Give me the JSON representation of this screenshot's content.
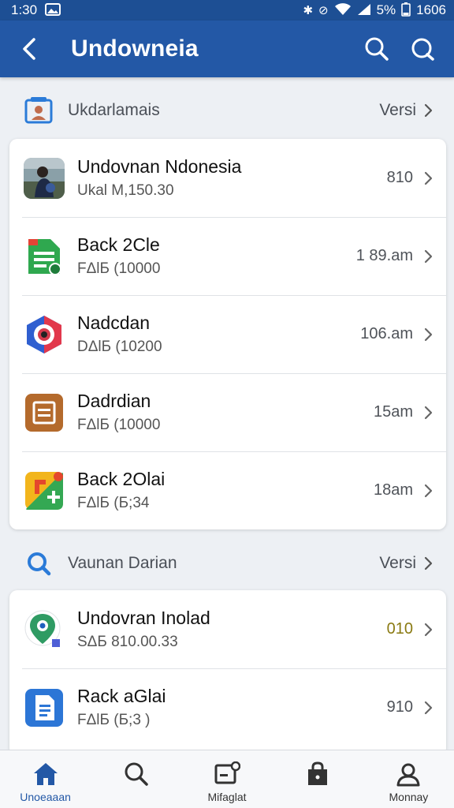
{
  "status_bar": {
    "time": "1:30",
    "battery": "5%",
    "clock_right": "1606"
  },
  "app_bar": {
    "title": "Undowneia"
  },
  "section1": {
    "title": "Ukdarlamais",
    "action": "Versi",
    "items": [
      {
        "title": "Undovnan Ndonesia",
        "subtitle": "Ukal M,150.30",
        "meta": "810",
        "icon": "photo-avatar-icon"
      },
      {
        "title": "Back 2Cle",
        "subtitle": "FΔlБ (10000",
        "meta": "1 89.am",
        "icon": "sheets-icon"
      },
      {
        "title": "Nadcdan",
        "subtitle": "DΔlБ (10200",
        "meta": "106.am",
        "icon": "target-icon"
      },
      {
        "title": "Dadrdian",
        "subtitle": "FΔlБ (10000",
        "meta": "15am",
        "icon": "notes-icon"
      },
      {
        "title": "Back 2Olai",
        "subtitle": "FΔlБ (Б;34",
        "meta": "18am",
        "icon": "colorful-app-icon"
      }
    ]
  },
  "section2": {
    "title": "Vaunan Darian",
    "action": "Versi",
    "items": [
      {
        "title": "Undovran Inolad",
        "subtitle": "SΔБ 810.00.33",
        "meta": "010",
        "icon": "location-pin-icon"
      },
      {
        "title": "Rack aGlai",
        "subtitle": "FΔlБ (Б;3 )",
        "meta": "910",
        "icon": "docs-icon"
      }
    ]
  },
  "bottom_nav": [
    {
      "label": "Unoeaaan",
      "icon": "home-icon"
    },
    {
      "label": "",
      "icon": "search-icon"
    },
    {
      "label": "Mifaglat",
      "icon": "message-icon"
    },
    {
      "label": "",
      "icon": "bag-icon"
    },
    {
      "label": "Monnay",
      "icon": "profile-icon"
    }
  ],
  "colors": {
    "app_bar": "#2358a6",
    "status_bar": "#1d4f94",
    "accent": "#2358a6",
    "meta_highlight": "#8a7a12"
  }
}
